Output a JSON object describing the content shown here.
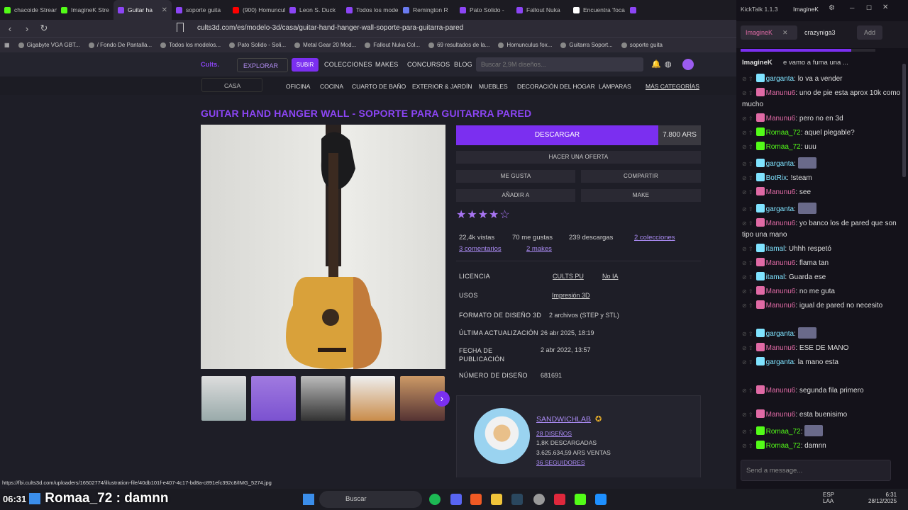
{
  "browser": {
    "tabs": [
      {
        "label": "chacoide Stream",
        "color": "#53fc18"
      },
      {
        "label": "ImagineK Stre",
        "color": "#53fc18"
      },
      {
        "label": "Guitar ha",
        "color": "#8c45f5",
        "active": true
      },
      {
        "label": "soporte guita",
        "color": "#8c45f5"
      },
      {
        "label": "(900) Homuncul",
        "color": "#ff0000"
      },
      {
        "label": "Leon S. Duck",
        "color": "#8c45f5"
      },
      {
        "label": "Todos los model",
        "color": "#8c45f5"
      },
      {
        "label": "Remington R",
        "color": "#6a7bf0"
      },
      {
        "label": "Pato Solido -",
        "color": "#8c45f5"
      },
      {
        "label": "Fallout Nuka",
        "color": "#8c45f5"
      },
      {
        "label": "Encuentra 'foca",
        "color": "#ffffff"
      },
      {
        "label": "",
        "color": "#8c45f5"
      }
    ],
    "url": "cults3d.com/es/modelo-3d/casa/guitar-hand-hanger-wall-soporte-para-guitarra-pared",
    "bookmarks": [
      "Gigabyte VGA GBT...",
      "/ Fondo De Pantalla...",
      "Todos los modelos...",
      "Pato Solido - Soli...",
      "Metal Gear 20 Mod...",
      "Fallout Nuka Col...",
      "69 resultados de la...",
      "Homunculus fox...",
      "Guitarra Soport...",
      "soporte guita"
    ],
    "status_url": "https://fbi.cults3d.com/uploaders/16502774/illustration-file/40db101f-e407-4c17-bd8a-c891efc392c8/IMG_5274.jpg"
  },
  "site": {
    "logo": "Cults.",
    "nav": {
      "explorar": "EXPLORAR",
      "subir": "SUBIR",
      "colecciones": "COLECCIONES",
      "makes": "MAKES",
      "concursos": "CONCURSOS",
      "blog": "BLOG",
      "search_placeholder": "Buscar 2,9M diseños..."
    },
    "categories": {
      "selected": "CASA",
      "items": [
        "OFICINA",
        "COCINA",
        "CUARTO DE BAÑO",
        "EXTERIOR & JARDÍN",
        "MUEBLES",
        "DECORACIÓN DEL HOGAR",
        "LÁMPARAS",
        "MÁS CATEGORÍAS"
      ]
    },
    "title": "GUITAR HAND HANGER WALL - SOPORTE PARA GUITARRA PARED",
    "download_label": "DESCARGAR",
    "price": "7.800 ARS",
    "offer_label": "HACER UNA OFERTA",
    "like_label": "ME GUSTA",
    "share_label": "COMPARTIR",
    "add_label": "AÑADIR A",
    "make_label": "MAKE",
    "rating": "4",
    "stats": {
      "views": "22,4k vistas",
      "likes": "70 me gustas",
      "downloads": "239 descargas",
      "collections": "2 colecciones",
      "comments": "3 comentarios",
      "makes": "2 makes"
    },
    "details": {
      "licencia_label": "LICENCIA",
      "licencia_val": "CULTS PU",
      "ia_val": "No IA",
      "usos_label": "USOS",
      "usos_val": "Impresión 3D",
      "formato_label": "FORMATO DE DISEÑO 3D",
      "formato_val": "2 archivos (STEP y STL)",
      "actualizacion_label": "ÚLTIMA ACTUALIZACIÓN",
      "actualizacion_val": "26 abr 2025, 18:19",
      "publicacion_label": "FECHA DE PUBLICACIÓN",
      "publicacion_val": "2 abr 2022, 13:57",
      "numero_label": "NÚMERO DE DISEÑO",
      "numero_val": "681691"
    },
    "creator": {
      "name": "SANDWICHLAB",
      "designs": "28 DISEÑOS",
      "downloads": "1,8K DESCARGADAS",
      "sales": "3.625.634,59 ARS VENTAS",
      "followers": "36 SEGUIDORES"
    }
  },
  "overlay": {
    "text": "Romaa_72 : damnn"
  },
  "taskbar": {
    "search": "Buscar",
    "time": "6:31",
    "date": "28/12/2025",
    "lang": "ESP",
    "lang2": "LAA",
    "left_time": "06:31"
  },
  "chat": {
    "app_title": "KickTalk 1.1.3",
    "user": "ImagineK",
    "tabs": [
      "ImagineK",
      "crazyniga3"
    ],
    "add_label": "Add",
    "progress": 0.82,
    "streamer": "ImagineK",
    "stream_title": "e vamo a fuma una ...",
    "input_placeholder": "Send a message...",
    "messages": [
      {
        "user": "garganta",
        "text": "lo va a vender",
        "color": "#7fe3ff"
      },
      {
        "user": "Manunu6",
        "text": "uno de pie esta aprox 10k como mucho",
        "color": "#e06aa5"
      },
      {
        "user": "Manunu6",
        "text": "pero no en 3d",
        "color": "#e06aa5"
      },
      {
        "user": "Romaa_72",
        "text": "aquel plegable?",
        "color": "#53fc18"
      },
      {
        "user": "Romaa_72",
        "text": "uuu",
        "color": "#53fc18"
      },
      {
        "user": "garganta",
        "text": "",
        "color": "#7fe3ff"
      },
      {
        "user": "BotRix",
        "text": "!steam",
        "color": "#7fe3ff"
      },
      {
        "user": "Manunu6",
        "text": "see",
        "color": "#e06aa5"
      },
      {
        "user": "garganta",
        "text": "",
        "color": "#7fe3ff"
      },
      {
        "user": "Manunu6",
        "text": "yo banco los de pared que son tipo una mano",
        "color": "#e06aa5"
      },
      {
        "user": "itamal",
        "text": "Uhhh respetó",
        "color": "#7fe3ff"
      },
      {
        "user": "Manunu6",
        "text": "flama tan",
        "color": "#e06aa5"
      },
      {
        "user": "itamal",
        "text": "Guarda ese",
        "color": "#7fe3ff"
      },
      {
        "user": "Manunu6",
        "text": "no me guta",
        "color": "#e06aa5"
      },
      {
        "user": "Manunu6",
        "text": "igual de pared no necesito",
        "color": "#e06aa5"
      },
      {
        "user": "garganta",
        "text": "",
        "color": "#7fe3ff"
      },
      {
        "user": "Manunu6",
        "text": "ESE DE MANO",
        "color": "#e06aa5"
      },
      {
        "user": "garganta",
        "text": "la mano esta",
        "color": "#7fe3ff"
      },
      {
        "user": "Manunu6",
        "text": "segunda fila primero",
        "color": "#e06aa5"
      },
      {
        "user": "Manunu6",
        "text": "esta buenisimo",
        "color": "#e06aa5"
      },
      {
        "user": "Romaa_72",
        "text": "",
        "color": "#53fc18"
      },
      {
        "user": "Romaa_72",
        "text": "damnn",
        "color": "#53fc18"
      }
    ]
  }
}
